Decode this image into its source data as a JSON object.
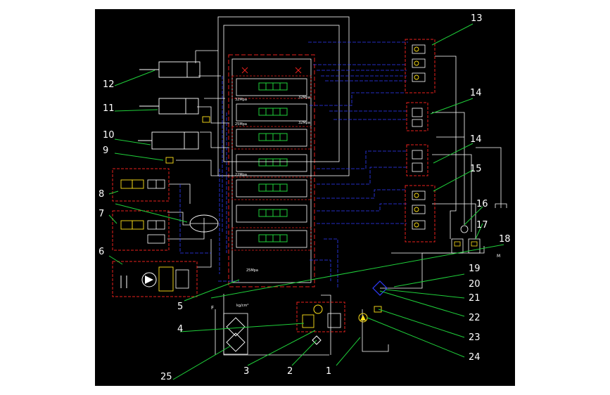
{
  "callouts": {
    "c1": "1",
    "c2": "2",
    "c3": "3",
    "c4": "4",
    "c5": "5",
    "c6": "6",
    "c7": "7",
    "c8": "8",
    "c9": "9",
    "c10": "10",
    "c11": "11",
    "c12": "12",
    "c13": "13",
    "c14a": "14",
    "c14b": "14",
    "c15": "15",
    "c16": "16",
    "c17": "17",
    "c18": "18",
    "c19": "19",
    "c20": "20",
    "c21": "21",
    "c22": "22",
    "c23": "23",
    "c24": "24",
    "c25": "25"
  },
  "labels": {
    "pressure_a": "32Mpa",
    "pressure_b": "32Mpa",
    "pressure_c": "25Mpa",
    "pressure_d": "32Mpa",
    "pressure_e": "22Mpa",
    "pressure_f": "25Mpa",
    "unit_kg": "kg/cm²",
    "filter_f": "F",
    "motor_m": "M"
  },
  "colors": {
    "background": "#000000",
    "line_white": "#ffffff",
    "line_red": "#e8211d",
    "line_blue": "#2f3cff",
    "leader_green": "#1fcf3a",
    "valve_yellow": "#ffe21a",
    "callout_text": "#ffffff"
  }
}
